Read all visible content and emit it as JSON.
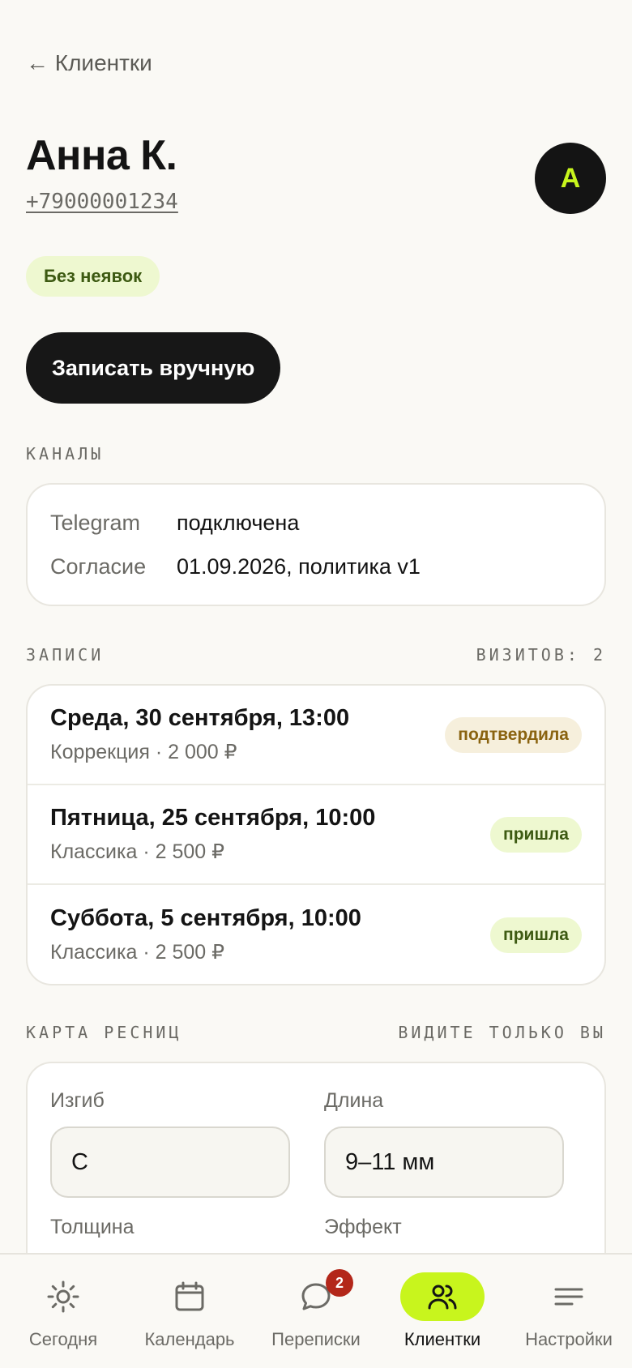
{
  "nav": {
    "back_label": "← Клиентки"
  },
  "client": {
    "name": "Анна К.",
    "phone": "+79000001234",
    "avatar_letter": "А",
    "tag": "Без неявок"
  },
  "actions": {
    "book_manual": "Записать вручную"
  },
  "channels": {
    "label": "КАНАЛЫ",
    "rows": [
      {
        "key": "Telegram",
        "value": "подключена"
      },
      {
        "key": "Согласие",
        "value": "01.09.2026, политика v1"
      }
    ]
  },
  "appointments": {
    "label": "ЗАПИСИ",
    "visits": "ВИЗИТОВ: 2",
    "items": [
      {
        "date": "Среда, 30 сентября, 13:00",
        "service": "Коррекция · 2 000 ₽",
        "status": "подтвердила",
        "status_kind": "confirmed"
      },
      {
        "date": "Пятница, 25 сентября, 10:00",
        "service": "Классика · 2 500 ₽",
        "status": "пришла",
        "status_kind": "came"
      },
      {
        "date": "Суббота, 5 сентября, 10:00",
        "service": "Классика · 2 500 ₽",
        "status": "пришла",
        "status_kind": "came"
      }
    ]
  },
  "lash_map": {
    "label": "КАРТА РЕСНИЦ",
    "privacy": "ВИДИТЕ ТОЛЬКО ВЫ",
    "curl_label": "Изгиб",
    "curl_value": "C",
    "length_label": "Длина",
    "length_value": "9–11 мм",
    "thickness_label": "Толщина",
    "effect_label": "Эффект"
  },
  "tabbar": {
    "items": [
      {
        "label": "Сегодня",
        "icon": "sun-icon"
      },
      {
        "label": "Календарь",
        "icon": "calendar-icon"
      },
      {
        "label": "Переписки",
        "icon": "chat-icon",
        "badge": "2"
      },
      {
        "label": "Клиентки",
        "icon": "users-icon",
        "active": true
      },
      {
        "label": "Настройки",
        "icon": "menu-icon"
      }
    ]
  },
  "colors": {
    "accent": "#c8f51d",
    "dark": "#141414",
    "background": "#faf9f5",
    "badge": "#b3271a"
  }
}
